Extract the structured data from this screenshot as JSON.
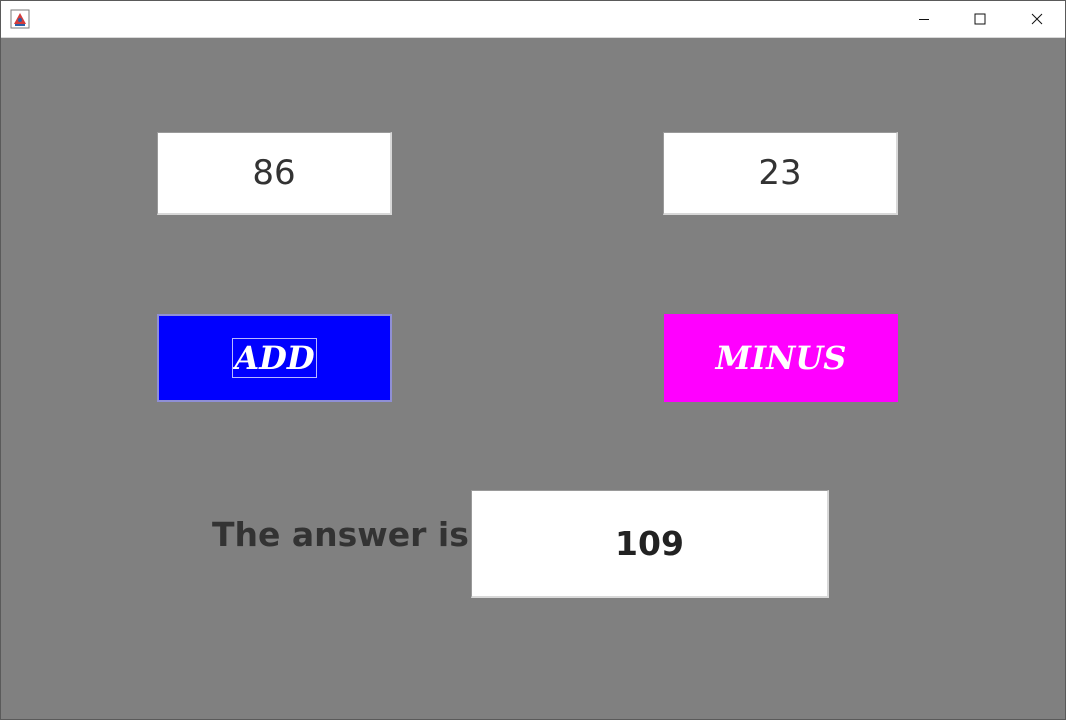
{
  "window": {
    "icon": "java-app-icon",
    "controls": {
      "minimize": "minimize-icon",
      "maximize": "maximize-icon",
      "close": "close-icon"
    }
  },
  "inputs": {
    "first_number": "86",
    "second_number": "23"
  },
  "buttons": {
    "add_label": "ADD",
    "minus_label": "MINUS"
  },
  "result": {
    "label": "The answer is",
    "value": "109"
  },
  "colors": {
    "background": "#808080",
    "add_button": "#0000ff",
    "minus_button": "#ff00ff"
  }
}
